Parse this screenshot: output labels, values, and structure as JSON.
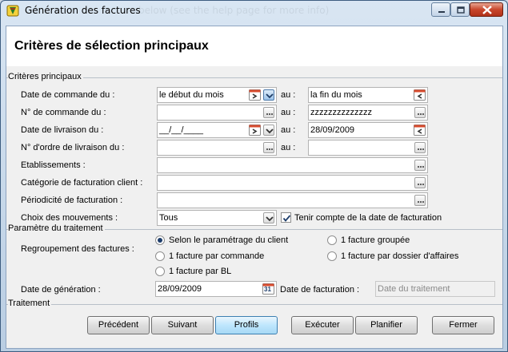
{
  "window": {
    "title": "Génération des factures",
    "ghost_text": "below (see the help page for more info)"
  },
  "main_title": "Critères de sélection principaux",
  "groups": {
    "criteres": "Critères principaux",
    "parametre": "Paramètre du traitement",
    "traitement": "Traitement"
  },
  "criteria": {
    "date_commande": {
      "label": "Date de commande du :",
      "from": "le début du mois",
      "au": "au :",
      "to": "la fin du mois"
    },
    "num_commande": {
      "label": "N° de commande du :",
      "from": "",
      "au": "au :",
      "to": "zzzzzzzzzzzzzz"
    },
    "date_livraison": {
      "label": "Date de livraison du :",
      "from": "__/__/____",
      "au": "au :",
      "to": "28/09/2009"
    },
    "num_ordre_livraison": {
      "label": "N° d'ordre de livraison du :",
      "from": "",
      "au": "au :",
      "to": ""
    },
    "etablissements": {
      "label": "Etablissements :",
      "value": ""
    },
    "categorie": {
      "label": "Catégorie de facturation client :",
      "value": ""
    },
    "periodicite": {
      "label": "Périodicité de facturation :",
      "value": ""
    },
    "mouvements": {
      "label": "Choix des mouvements :",
      "value": "Tous"
    },
    "tenir_compte": {
      "label": "Tenir compte de la date de facturation",
      "checked": true
    }
  },
  "parametre": {
    "regroupement_label": "Regroupement des factures :",
    "options": {
      "selon_client": {
        "label": "Selon le paramétrage du client",
        "selected": true
      },
      "groupee": {
        "label": "1 facture groupée",
        "selected": false
      },
      "par_commande": {
        "label": "1 facture par commande",
        "selected": false
      },
      "par_dossier": {
        "label": "1 facture par dossier d'affaires",
        "selected": false
      },
      "par_bl": {
        "label": "1 facture par BL",
        "selected": false
      }
    },
    "date_generation_label": "Date de génération :",
    "date_generation": "28/09/2009",
    "calendar_day": "31",
    "date_facturation_label": "Date de facturation :",
    "date_facturation": "Date du traitement"
  },
  "buttons": {
    "precedent": "Précédent",
    "suivant": "Suivant",
    "profils": "Profils",
    "executer": "Exécuter",
    "planifier": "Planifier",
    "fermer": "Fermer"
  }
}
